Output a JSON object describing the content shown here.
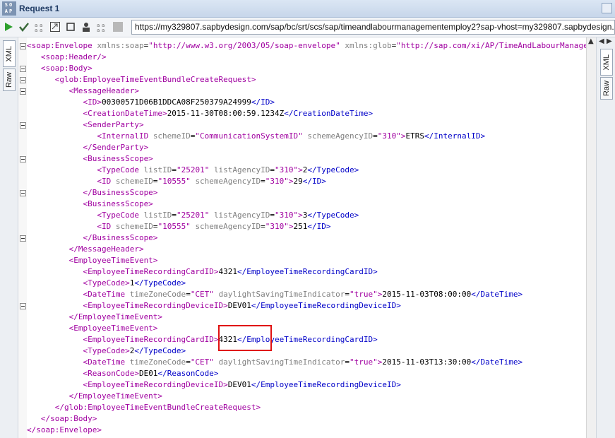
{
  "window": {
    "logo_top": "SO",
    "logo_bottom": "AP",
    "title": "Request 1"
  },
  "toolbar": {
    "url": "https://my329807.sapbydesign.com/sap/bc/srt/scs/sap/timeandlabourmanagementemploy2?sap-vhost=my329807.sapbydesign.com"
  },
  "side_tabs": {
    "xml": "XML",
    "raw": "Raw"
  },
  "editor": {
    "lines": [
      [
        [
          "t-tag",
          "<soap:Envelope "
        ],
        [
          "t-attr",
          "xmlns:soap"
        ],
        [
          "t-text",
          "="
        ],
        [
          "t-val",
          "\"http://www.w3.org/2003/05/soap-envelope\""
        ],
        [
          "t-text",
          " "
        ],
        [
          "t-attr",
          "xmlns:glob"
        ],
        [
          "t-text",
          "="
        ],
        [
          "t-val",
          "\"http://sap.com/xi/AP/TimeAndLabourManagement/Global\""
        ],
        [
          "t-tag",
          ">"
        ]
      ],
      [
        [
          "t-tag",
          "   <soap:Header/>"
        ]
      ],
      [
        [
          "t-tag",
          "   <soap:Body>"
        ]
      ],
      [
        [
          "t-tag",
          "      <glob:EmployeeTimeEventBundleCreateRequest>"
        ]
      ],
      [
        [
          "t-tag",
          "         <MessageHeader>"
        ]
      ],
      [
        [
          "t-tag",
          "            <ID>"
        ],
        [
          "t-text",
          "00300571D06B1DDCA08F250379A24999"
        ],
        [
          "t-tagb",
          "</ID>"
        ]
      ],
      [
        [
          "t-tag",
          "            <CreationDateTime>"
        ],
        [
          "t-text",
          "2015-11-30T08:00:59.1234Z"
        ],
        [
          "t-tagb",
          "</CreationDateTime>"
        ]
      ],
      [
        [
          "t-tag",
          "            <SenderParty>"
        ]
      ],
      [
        [
          "t-tag",
          "               <InternalID "
        ],
        [
          "t-attr",
          "schemeID"
        ],
        [
          "t-text",
          "="
        ],
        [
          "t-val",
          "\"CommunicationSystemID\""
        ],
        [
          "t-text",
          " "
        ],
        [
          "t-attr",
          "schemeAgencyID"
        ],
        [
          "t-text",
          "="
        ],
        [
          "t-val",
          "\"310\""
        ],
        [
          "t-tag",
          ">"
        ],
        [
          "t-text",
          "ETRS"
        ],
        [
          "t-tagb",
          "</InternalID>"
        ]
      ],
      [
        [
          "t-tag",
          "            </SenderParty>"
        ]
      ],
      [
        [
          "t-tag",
          "            <BusinessScope>"
        ]
      ],
      [
        [
          "t-tag",
          "               <TypeCode "
        ],
        [
          "t-attr",
          "listID"
        ],
        [
          "t-text",
          "="
        ],
        [
          "t-val",
          "\"25201\""
        ],
        [
          "t-text",
          " "
        ],
        [
          "t-attr",
          "listAgencyID"
        ],
        [
          "t-text",
          "="
        ],
        [
          "t-val",
          "\"310\""
        ],
        [
          "t-tag",
          ">"
        ],
        [
          "t-text",
          "2"
        ],
        [
          "t-tagb",
          "</TypeCode>"
        ]
      ],
      [
        [
          "t-tag",
          "               <ID "
        ],
        [
          "t-attr",
          "schemeID"
        ],
        [
          "t-text",
          "="
        ],
        [
          "t-val",
          "\"10555\""
        ],
        [
          "t-text",
          " "
        ],
        [
          "t-attr",
          "schemeAgencyID"
        ],
        [
          "t-text",
          "="
        ],
        [
          "t-val",
          "\"310\""
        ],
        [
          "t-tag",
          ">"
        ],
        [
          "t-text",
          "29"
        ],
        [
          "t-tagb",
          "</ID>"
        ]
      ],
      [
        [
          "t-tag",
          "            </BusinessScope>"
        ]
      ],
      [
        [
          "t-tag",
          "            <BusinessScope>"
        ]
      ],
      [
        [
          "t-tag",
          "               <TypeCode "
        ],
        [
          "t-attr",
          "listID"
        ],
        [
          "t-text",
          "="
        ],
        [
          "t-val",
          "\"25201\""
        ],
        [
          "t-text",
          " "
        ],
        [
          "t-attr",
          "listAgencyID"
        ],
        [
          "t-text",
          "="
        ],
        [
          "t-val",
          "\"310\""
        ],
        [
          "t-tag",
          ">"
        ],
        [
          "t-text",
          "3"
        ],
        [
          "t-tagb",
          "</TypeCode>"
        ]
      ],
      [
        [
          "t-tag",
          "               <ID "
        ],
        [
          "t-attr",
          "schemeID"
        ],
        [
          "t-text",
          "="
        ],
        [
          "t-val",
          "\"10555\""
        ],
        [
          "t-text",
          " "
        ],
        [
          "t-attr",
          "schemeAgencyID"
        ],
        [
          "t-text",
          "="
        ],
        [
          "t-val",
          "\"310\""
        ],
        [
          "t-tag",
          ">"
        ],
        [
          "t-text",
          "251"
        ],
        [
          "t-tagb",
          "</ID>"
        ]
      ],
      [
        [
          "t-tag",
          "            </BusinessScope>"
        ]
      ],
      [
        [
          "t-tag",
          "         </MessageHeader>"
        ]
      ],
      [
        [
          "t-tag",
          "         <EmployeeTimeEvent>"
        ]
      ],
      [
        [
          "t-tag",
          "            <EmployeeTimeRecordingCardID>"
        ],
        [
          "t-text",
          "4321"
        ],
        [
          "t-tagb",
          "</EmployeeTimeRecordingCardID>"
        ]
      ],
      [
        [
          "t-tag",
          "            <TypeCode>"
        ],
        [
          "t-text",
          "1"
        ],
        [
          "t-tagb",
          "</TypeCode>"
        ]
      ],
      [
        [
          "t-tag",
          "            <DateTime "
        ],
        [
          "t-attr",
          "timeZoneCode"
        ],
        [
          "t-text",
          "="
        ],
        [
          "t-val",
          "\"CET\""
        ],
        [
          "t-text",
          " "
        ],
        [
          "t-attr",
          "daylightSavingTimeIndicator"
        ],
        [
          "t-text",
          "="
        ],
        [
          "t-val",
          "\"true\""
        ],
        [
          "t-tag",
          ">"
        ],
        [
          "t-text",
          "2015-11-03T08:00:00"
        ],
        [
          "t-tagb",
          "</DateTime>"
        ]
      ],
      [
        [
          "t-tag",
          "            <EmployeeTimeRecordingDeviceID>"
        ],
        [
          "t-text",
          "DEV01"
        ],
        [
          "t-tagb",
          "</EmployeeTimeRecordingDeviceID>"
        ]
      ],
      [
        [
          "t-tag",
          "         </EmployeeTimeEvent>"
        ]
      ],
      [
        [
          "t-tag",
          "         <EmployeeTimeEvent>"
        ]
      ],
      [
        [
          "t-tag",
          "            <EmployeeTimeRecordingCardID>"
        ],
        [
          "t-text",
          "4321"
        ],
        [
          "t-tagb",
          "</EmployeeTimeRecordingCardID>"
        ]
      ],
      [
        [
          "t-tag",
          "            <TypeCode>"
        ],
        [
          "t-text",
          "2"
        ],
        [
          "t-tagb",
          "</TypeCode>"
        ]
      ],
      [
        [
          "t-tag",
          "            <DateTime "
        ],
        [
          "t-attr",
          "timeZoneCode"
        ],
        [
          "t-text",
          "="
        ],
        [
          "t-val",
          "\"CET\""
        ],
        [
          "t-text",
          " "
        ],
        [
          "t-attr",
          "daylightSavingTimeIndicator"
        ],
        [
          "t-text",
          "="
        ],
        [
          "t-val",
          "\"true\""
        ],
        [
          "t-tag",
          ">"
        ],
        [
          "t-text",
          "2015-11-03T13:30:00"
        ],
        [
          "t-tagb",
          "</DateTime>"
        ]
      ],
      [
        [
          "t-tag",
          "            <ReasonCode>"
        ],
        [
          "t-text",
          "DE01"
        ],
        [
          "t-tagb",
          "</ReasonCode>"
        ]
      ],
      [
        [
          "t-tag",
          "            <EmployeeTimeRecordingDeviceID>"
        ],
        [
          "t-text",
          "DEV01"
        ],
        [
          "t-tagb",
          "</EmployeeTimeRecordingDeviceID>"
        ]
      ],
      [
        [
          "t-tag",
          "         </EmployeeTimeEvent>"
        ]
      ],
      [
        [
          "t-tag",
          "      </glob:EmployeeTimeEventBundleCreateRequest>"
        ]
      ],
      [
        [
          "t-tag",
          "   </soap:Body>"
        ]
      ],
      [
        [
          "t-tag",
          "</soap:Envelope>"
        ]
      ]
    ]
  },
  "colors": {
    "tag": "#a000a0",
    "closing_tag": "#0000c8",
    "attribute": "#808080",
    "highlight": "#e01010"
  }
}
